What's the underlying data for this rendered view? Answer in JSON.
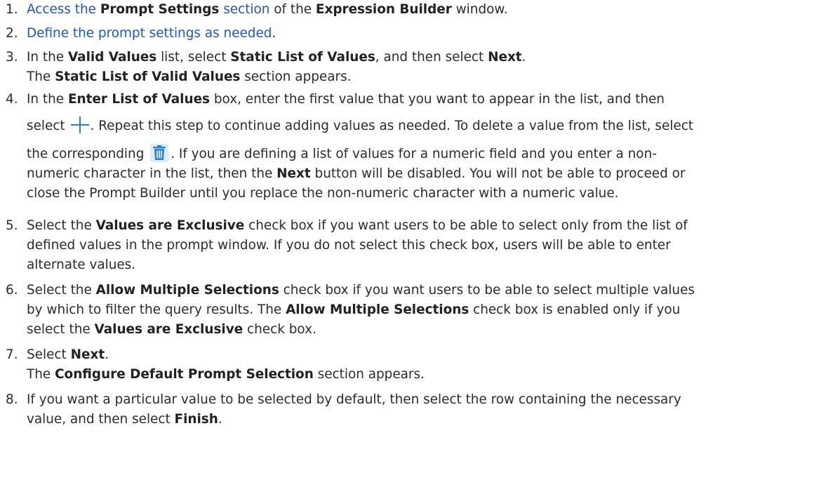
{
  "steps": [
    {
      "num": "1.",
      "parts": [
        "Access the ",
        "Prompt Settings",
        " section",
        " of the ",
        "Expression Builder",
        " window."
      ]
    },
    {
      "num": "2.",
      "parts": [
        "Define the prompt settings as needed",
        "."
      ]
    },
    {
      "num": "3.",
      "line1": [
        "In the ",
        "Valid Values",
        " list, select ",
        "Static List of Values",
        ", and then select ",
        "Next",
        "."
      ],
      "line2": [
        "The ",
        "Static List of Valid Values",
        " section appears."
      ]
    },
    {
      "num": "4.",
      "line1": [
        "In the ",
        "Enter List of Values",
        " box, enter the first value that you want to appear in the list, and then"
      ],
      "line2": [
        "select ",
        ". Repeat this step to continue adding values as needed. To delete a value from the list, select"
      ],
      "line3": [
        "the corresponding ",
        ". If you are defining a list of values for a numeric field and you enter a non-"
      ],
      "line4": [
        "numeric character in the list, then the ",
        "Next",
        " button will be disabled. You will not be able to proceed or"
      ],
      "line5": [
        "close the Prompt Builder until you replace the non-numeric character with a numeric value."
      ]
    },
    {
      "num": "5.",
      "line1": [
        "Select the ",
        "Values are Exclusive",
        " check box if you want users to be able to select only from the list of"
      ],
      "line2": [
        "defined values in the prompt window. If you do not select this check box, users will be able to enter"
      ],
      "line3": [
        "alternate values."
      ]
    },
    {
      "num": "6.",
      "line1": [
        "Select the ",
        "Allow Multiple Selections",
        " check box if you want users to be able to select multiple values"
      ],
      "line2": [
        "by which to filter the query results. The ",
        "Allow Multiple Selections",
        " check box is enabled only if you"
      ],
      "line3": [
        "select the ",
        "Values are Exclusive",
        " check box."
      ]
    },
    {
      "num": "7.",
      "line1": [
        "Select ",
        "Next",
        "."
      ],
      "line2": [
        "The ",
        "Configure Default Prompt Selection",
        " section appears."
      ]
    },
    {
      "num": "8.",
      "line1": [
        "If you want a particular value to be selected by default, then select the row containing the necessary"
      ],
      "line2": [
        "value, and then select ",
        "Finish",
        "."
      ]
    }
  ],
  "colors": {
    "link": "#1f54c8",
    "icon": "#2a7fd0",
    "text": "#2b2b2b"
  },
  "icons": {
    "add": "plus-icon",
    "delete": "trash-icon"
  }
}
